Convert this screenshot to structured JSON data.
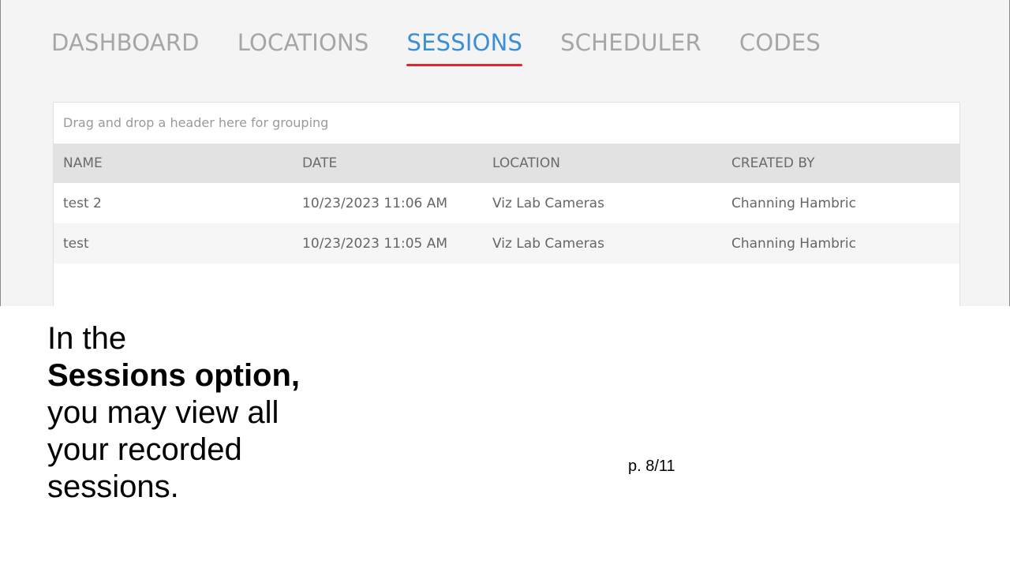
{
  "nav": {
    "tabs": [
      {
        "label": "DASHBOARD",
        "active": false
      },
      {
        "label": "LOCATIONS",
        "active": false
      },
      {
        "label": "SESSIONS",
        "active": true
      },
      {
        "label": "SCHEDULER",
        "active": false
      },
      {
        "label": "CODES",
        "active": false
      }
    ]
  },
  "grid": {
    "group_placeholder": "Drag and drop a header here for grouping",
    "columns": [
      "NAME",
      "DATE",
      "LOCATION",
      "CREATED BY"
    ],
    "rows": [
      {
        "name": "test 2",
        "date": "10/23/2023 11:06 AM",
        "location": "Viz Lab Cameras",
        "created_by": "Channing Hambric"
      },
      {
        "name": "test",
        "date": "10/23/2023 11:05 AM",
        "location": "Viz Lab Cameras",
        "created_by": "Channing Hambric"
      }
    ]
  },
  "caption": {
    "line1": "In the",
    "bold": "Sessions option,",
    "line3": "you may view all",
    "line4": "your recorded",
    "line5": "sessions."
  },
  "page_number": "p. 8/11",
  "colors": {
    "active_tab": "#3a8fd6",
    "active_underline": "#e5242b",
    "inactive_tab": "#a6a6a6",
    "header_bg": "#e2e2e2"
  }
}
